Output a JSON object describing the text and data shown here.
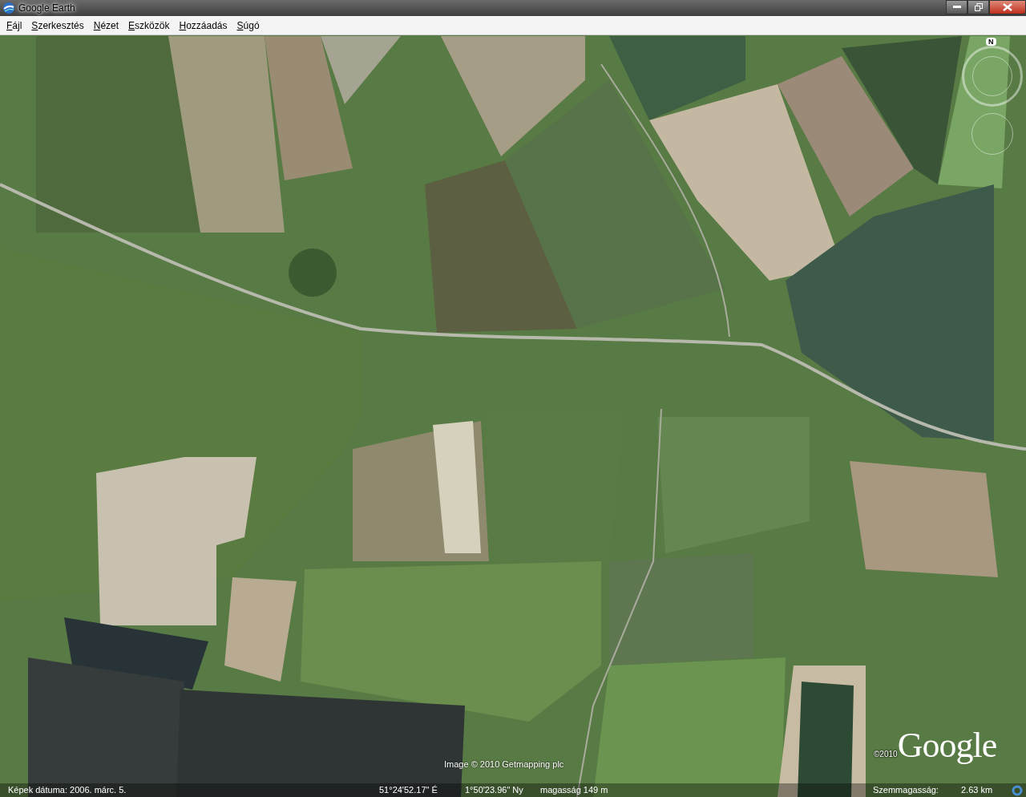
{
  "window": {
    "title": "Google Earth"
  },
  "menu": [
    {
      "label": "Fájl"
    },
    {
      "label": "Szerkesztés"
    },
    {
      "label": "Nézet"
    },
    {
      "label": "Eszközök"
    },
    {
      "label": "Hozzáadás"
    },
    {
      "label": "Súgó"
    }
  ],
  "map": {
    "compass": "N",
    "image_credit": "Image © 2010 Getmapping plc",
    "copyright": "©2010",
    "logo": "Google"
  },
  "status_bar": {
    "imagery_date": "Képek dátuma: 2006. márc.  5.",
    "latitude": "51°24'52.17\" É",
    "longitude": "1°50'23.96\" Ny",
    "elevation": "magasság  149 m",
    "eye_altitude_label": "Szemmagasság:",
    "eye_altitude": "2.63 km"
  }
}
